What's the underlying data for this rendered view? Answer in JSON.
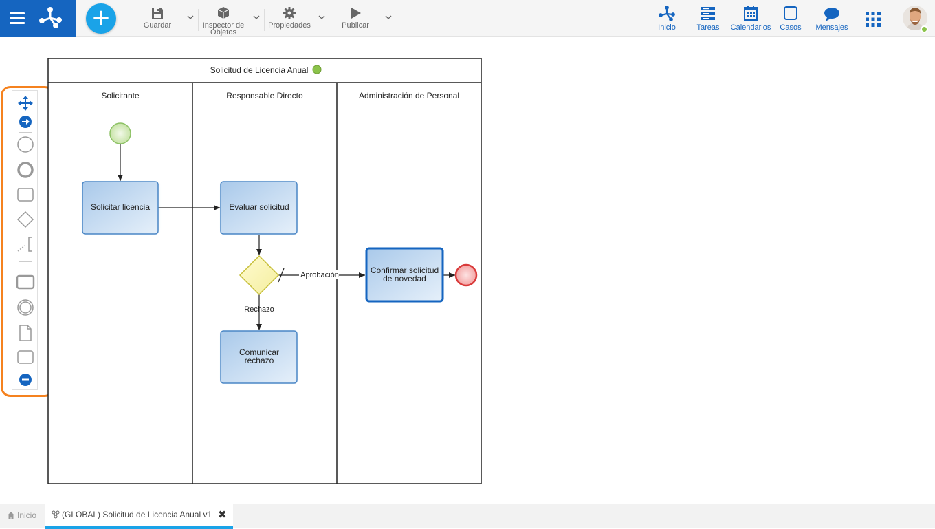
{
  "toolbar": {
    "save_label": "Guardar",
    "inspector_label_1": "Inspector de",
    "inspector_label_2": "Objetos",
    "properties_label": "Propiedades",
    "publish_label": "Publicar"
  },
  "nav": {
    "home": "Inicio",
    "tasks": "Tareas",
    "calendars": "Calendarios",
    "cases": "Casos",
    "messages": "Mensajes"
  },
  "colors": {
    "brand": "#1565c0",
    "accent": "#1aa3e8",
    "highlight": "#f5821f",
    "status_green": "#8bc34a"
  },
  "diagram": {
    "pool_title": "Solicitud de Licencia Anual",
    "lanes": [
      "Solicitante",
      "Responsable Directo",
      "Administración de Personal"
    ],
    "tasks": {
      "solicitar": "Solicitar licencia",
      "evaluar": "Evaluar solicitud",
      "confirmar_1": "Confirmar solicitud",
      "confirmar_2": "de novedad",
      "comunicar_1": "Comunicar",
      "comunicar_2": "rechazo"
    },
    "flows": {
      "approval": "Aprobación",
      "rejection": "Rechazo"
    }
  },
  "palette": {
    "items": [
      "move-icon",
      "connect-icon",
      "start-event-icon",
      "end-event-icon",
      "task-icon",
      "gateway-icon",
      "annotation-icon",
      "subprocess-icon",
      "intermediate-event-icon",
      "data-object-icon",
      "lane-icon",
      "collapse-icon"
    ]
  },
  "tabs": {
    "home": "Inicio",
    "active": "(GLOBAL) Solicitud de Licencia Anual v1"
  }
}
